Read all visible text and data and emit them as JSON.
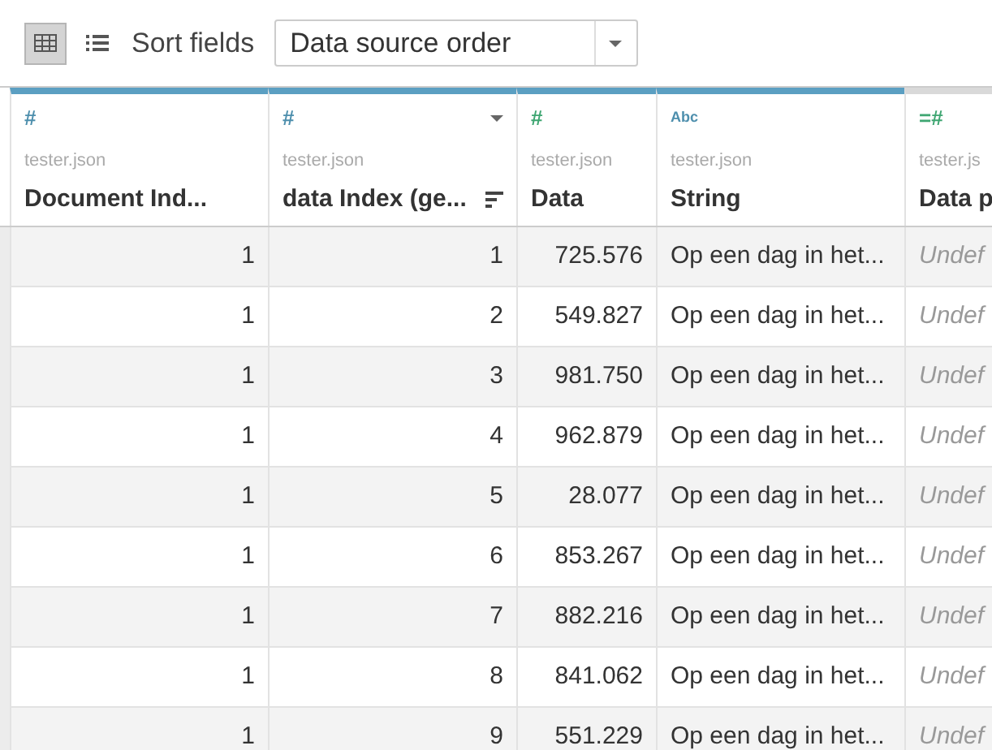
{
  "toolbar": {
    "views": [
      {
        "kind": "grid",
        "selected": true
      },
      {
        "kind": "list",
        "selected": false
      }
    ],
    "sort_label": "Sort fields",
    "sort_select": {
      "value": "Data source order"
    }
  },
  "table": {
    "columns": [
      {
        "type_label": "#",
        "color": "#4e8fad",
        "source": "tester.json",
        "name": "Document Ind...",
        "highlighted": true,
        "menu": false,
        "sorted": false
      },
      {
        "type_label": "#",
        "color": "#4e8fad",
        "source": "tester.json",
        "name": "data Index (ge...",
        "highlighted": true,
        "menu": true,
        "sorted": true
      },
      {
        "type_label": "#",
        "color": "#3fa672",
        "source": "tester.json",
        "name": "Data",
        "highlighted": true,
        "menu": false,
        "sorted": false
      },
      {
        "type_label": "Abc",
        "color": "#4e8fad",
        "source": "tester.json",
        "name": "String",
        "highlighted": true,
        "menu": false,
        "sorted": false
      },
      {
        "type_label": "=#",
        "color": "#3fa672",
        "source": "tester.js",
        "name": "Data p",
        "highlighted": false,
        "menu": false,
        "sorted": false
      }
    ],
    "rows": [
      [
        "1",
        "1",
        "725.576",
        "Op een dag in het...",
        "Undef"
      ],
      [
        "1",
        "2",
        "549.827",
        "Op een dag in het...",
        "Undef"
      ],
      [
        "1",
        "3",
        "981.750",
        "Op een dag in het...",
        "Undef"
      ],
      [
        "1",
        "4",
        "962.879",
        "Op een dag in het...",
        "Undef"
      ],
      [
        "1",
        "5",
        "28.077",
        "Op een dag in het...",
        "Undef"
      ],
      [
        "1",
        "6",
        "853.267",
        "Op een dag in het...",
        "Undef"
      ],
      [
        "1",
        "7",
        "882.216",
        "Op een dag in het...",
        "Undef"
      ],
      [
        "1",
        "8",
        "841.062",
        "Op een dag in het...",
        "Undef"
      ],
      [
        "1",
        "9",
        "551.229",
        "Op een dag in het...",
        "Undef"
      ]
    ]
  }
}
